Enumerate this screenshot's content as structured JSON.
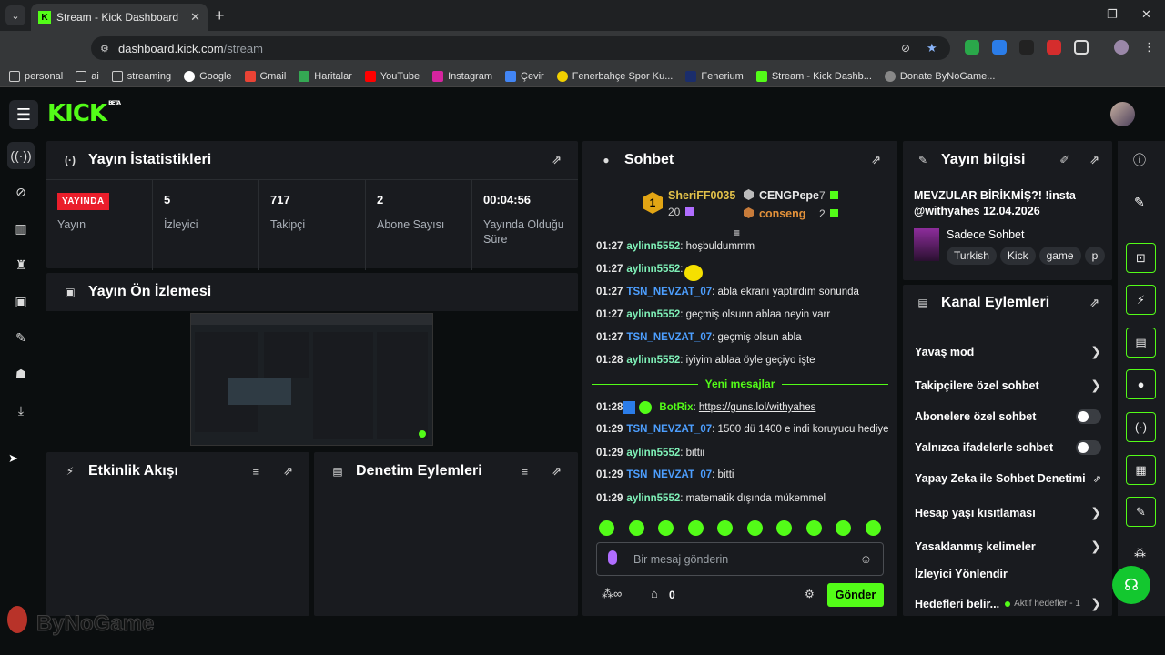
{
  "browser": {
    "tab_title": "Stream - Kick Dashboard",
    "tab_favicon": "K",
    "url_host": "dashboard.kick.com",
    "url_path": "/stream",
    "bookmarks": [
      {
        "label": "personal",
        "icon": "folder-icon"
      },
      {
        "label": "ai",
        "icon": "folder-icon"
      },
      {
        "label": "streaming",
        "icon": "folder-icon"
      },
      {
        "label": "Google",
        "icon": "google-icon"
      },
      {
        "label": "Gmail",
        "icon": "gmail-icon"
      },
      {
        "label": "Haritalar",
        "icon": "maps-icon"
      },
      {
        "label": "YouTube",
        "icon": "youtube-icon"
      },
      {
        "label": "Instagram",
        "icon": "instagram-icon"
      },
      {
        "label": "Çevir",
        "icon": "translate-icon"
      },
      {
        "label": "Fenerbahçe Spor Ku...",
        "icon": "fenerbahce-icon"
      },
      {
        "label": "Fenerium",
        "icon": "fenerium-icon"
      },
      {
        "label": "Stream - Kick Dashb...",
        "icon": "kick-icon"
      },
      {
        "label": "Donate ByNoGame...",
        "icon": "bynogame-icon"
      }
    ]
  },
  "kick": {
    "logo": "KICK",
    "logo_badge": "BETA"
  },
  "stats": {
    "title": "Yayın İstatistikleri",
    "live_badge": "YAYINDA",
    "items": [
      {
        "value": "",
        "label": "Yayın"
      },
      {
        "value": "5",
        "label": "İzleyici"
      },
      {
        "value": "717",
        "label": "Takipçi"
      },
      {
        "value": "2",
        "label": "Abone Sayısı"
      },
      {
        "value": "00:04:56",
        "label": "Yayında Olduğu Süre"
      }
    ]
  },
  "preview": {
    "title": "Yayın Ön İzlemesi"
  },
  "activity": {
    "title": "Etkinlik Akışı"
  },
  "moderation": {
    "title": "Denetim Eylemleri"
  },
  "chat": {
    "title": "Sohbet",
    "leaderboard": [
      {
        "rank": "1",
        "name": "SheriFF0035",
        "count": "20"
      },
      {
        "rank": "2",
        "name": "CENGPepe",
        "count": "7"
      },
      {
        "rank": "3",
        "name": "conseng",
        "count": "2"
      }
    ],
    "messages": [
      {
        "time": "01:27",
        "user": "aylinn5552",
        "text": "hoşbuldummm",
        "style": "u1"
      },
      {
        "time": "01:27",
        "user": "aylinn5552",
        "text": "",
        "style": "u1"
      },
      {
        "time": "01:27",
        "user": "TSN_NEVZAT_07",
        "text": "abla ekranı yaptırdım sonunda",
        "style": "u2"
      },
      {
        "time": "01:27",
        "user": "aylinn5552",
        "text": "geçmiş olsunn ablaa neyin varr",
        "style": "u1"
      },
      {
        "time": "01:27",
        "user": "TSN_NEVZAT_07",
        "text": "geçmiş olsun abla",
        "style": "u2"
      },
      {
        "time": "01:28",
        "user": "aylinn5552",
        "text": "iyiyim ablaa öyle geçiyo işte",
        "style": "u1"
      }
    ],
    "new_messages_label": "Yeni mesajlar",
    "messages_after": [
      {
        "time": "01:28",
        "user": "BotRix",
        "text": "https://guns.lol/withyahes",
        "style": "u3"
      },
      {
        "time": "01:29",
        "user": "TSN_NEVZAT_07",
        "text": "1500 dü 1400 e indi koruyucu hediye",
        "style": "u2"
      },
      {
        "time": "01:29",
        "user": "aylinn5552",
        "text": "bittii",
        "style": "u1"
      },
      {
        "time": "01:29",
        "user": "TSN_NEVZAT_07",
        "text": "bitti",
        "style": "u2"
      },
      {
        "time": "01:29",
        "user": "aylinn5552",
        "text": "matematik dışında mükemmel",
        "style": "u1"
      }
    ],
    "input_placeholder": "Bir mesaj gönderin",
    "points_value": "0",
    "send_label": "Gönder"
  },
  "stream_info": {
    "title": "Yayın bilgisi",
    "stream_title": "MEVZULAR BİRİKMİŞ?! !insta @withyahes 12.04.2026",
    "category": "Sadece Sohbet",
    "tags": [
      "Turkish",
      "Kick",
      "game",
      "p"
    ]
  },
  "channel_actions": {
    "title": "Kanal Eylemleri",
    "items": [
      {
        "label": "Yavaş mod",
        "control": "arrow"
      },
      {
        "label": "Takipçilere özel sohbet",
        "control": "arrow"
      },
      {
        "label": "Abonelere özel sohbet",
        "control": "toggle"
      },
      {
        "label": "Yalnızca ifadelerle sohbet",
        "control": "toggle"
      },
      {
        "label": "Yapay Zeka ile Sohbet Denetimi",
        "control": "external"
      },
      {
        "label": "Hesap yaşı kısıtlaması",
        "control": "arrow"
      },
      {
        "label": "Yasaklanmış kelimeler",
        "control": "arrow"
      },
      {
        "label": "İzleyici Yönlendir",
        "control": "none"
      },
      {
        "label": "Hedefleri belir...",
        "control": "arrow"
      }
    ],
    "goals_status": "Aktif hedefler - 1"
  },
  "watermark": "ByNoGame",
  "colors": {
    "accent": "#53fc18",
    "live": "#ea1e2b",
    "panel": "#191b1f",
    "bg": "#0b0e0f"
  }
}
